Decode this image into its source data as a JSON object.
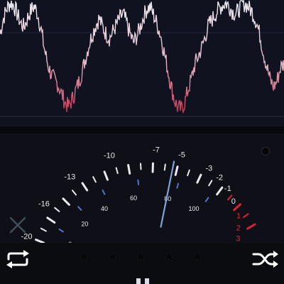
{
  "waveform": {
    "colors": {
      "high": "#ecebf2",
      "low": "#c8344f",
      "grid": "#2a2d3e"
    },
    "levels": [
      0.72,
      0.86,
      0.95,
      1.0,
      0.98,
      0.9,
      0.82,
      0.78,
      0.86,
      0.93,
      0.97,
      0.9,
      0.76,
      0.58,
      0.44,
      0.35,
      0.3,
      0.26,
      0.18,
      0.1,
      0.06,
      0.12,
      0.2,
      0.28,
      0.38,
      0.5,
      0.62,
      0.72,
      0.8,
      0.86,
      0.78,
      0.72,
      0.68,
      0.74,
      0.8,
      0.86,
      0.9,
      0.82,
      0.72,
      0.64,
      0.7,
      0.78,
      0.88,
      0.95,
      0.96,
      0.88,
      0.8,
      0.7,
      0.55,
      0.4,
      0.25,
      0.12,
      0.05,
      0.04,
      0.1,
      0.22,
      0.32,
      0.45,
      0.52,
      0.6,
      0.7,
      0.8,
      0.85,
      0.9,
      0.95,
      0.98,
      1.0,
      0.97,
      0.92,
      0.9,
      0.95,
      1.0,
      0.98,
      0.95,
      0.9,
      0.82,
      0.7,
      0.55,
      0.42,
      0.3,
      0.24,
      0.3,
      0.42,
      0.45
    ]
  },
  "vu_meter": {
    "db_labels": [
      "-20",
      "-16",
      "-13",
      "-10",
      "-7",
      "-5",
      "-3",
      "-2",
      "-1",
      "0",
      "1",
      "2",
      "3"
    ],
    "db_red_from": 10,
    "percent_labels": [
      "0",
      "20",
      "40",
      "60",
      "80",
      "100"
    ],
    "needle_level": 0.62,
    "colors": {
      "label": "#e9e9ef",
      "red": "#e0203a",
      "scale": "#e9e9ef",
      "needle": "#7fa2d6",
      "percent_tick": "#4f74c9"
    }
  },
  "controls": {
    "repeat_icon": "repeat-icon",
    "shuffle_icon": "shuffle-icon",
    "close_icon": "close-icon",
    "star_glyph": "★",
    "rating": 0,
    "stars": 5
  }
}
